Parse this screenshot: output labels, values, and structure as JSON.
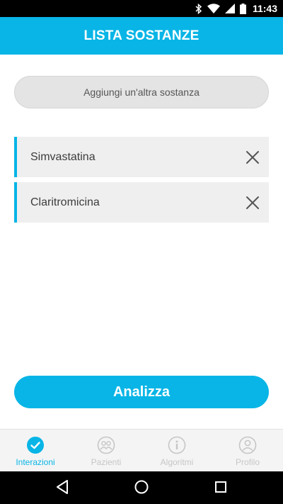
{
  "status_bar": {
    "time": "11:43",
    "icons": [
      "bluetooth-icon",
      "wifi-icon",
      "signal-icon",
      "battery-icon"
    ]
  },
  "header": {
    "title": "LISTA SOSTANZE"
  },
  "add_button": {
    "label": "Aggiungi un'altra sostanza"
  },
  "substances": [
    {
      "name": "Simvastatina",
      "remove_icon": "close-icon"
    },
    {
      "name": "Claritromicina",
      "remove_icon": "close-icon"
    }
  ],
  "analyze_button": {
    "label": "Analizza"
  },
  "bottom_nav": {
    "items": [
      {
        "label": "Interazioni",
        "icon": "check-circle-icon",
        "active": true
      },
      {
        "label": "Pazienti",
        "icon": "patients-icon",
        "active": false
      },
      {
        "label": "Algoritmi",
        "icon": "info-icon",
        "active": false
      },
      {
        "label": "Profilo",
        "icon": "profile-icon",
        "active": false
      }
    ]
  },
  "system_nav": {
    "icons": [
      "back-icon",
      "home-icon",
      "recents-icon"
    ]
  },
  "colors": {
    "accent": "#08b5e6",
    "inactive": "#c6c6c6",
    "list_bg": "#efefef"
  }
}
